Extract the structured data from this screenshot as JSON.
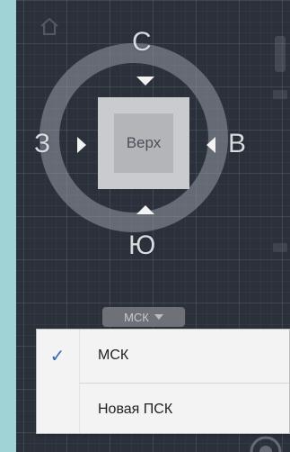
{
  "viewcube": {
    "compass": {
      "north": "С",
      "west": "З",
      "east": "В",
      "south": "Ю"
    },
    "face_label": "Верх"
  },
  "wcs_button": {
    "label": "МСК"
  },
  "wcs_menu": {
    "items": [
      {
        "label": "МСК",
        "checked": true,
        "check_glyph": "✓"
      },
      {
        "label": "Новая ПСК",
        "checked": false
      }
    ]
  },
  "colors": {
    "viewport_bg": "#2b313b",
    "checkmark": "#3a68b0",
    "menu_bg": "#f3f3f3",
    "outer_bg": "#9fd3d6"
  }
}
